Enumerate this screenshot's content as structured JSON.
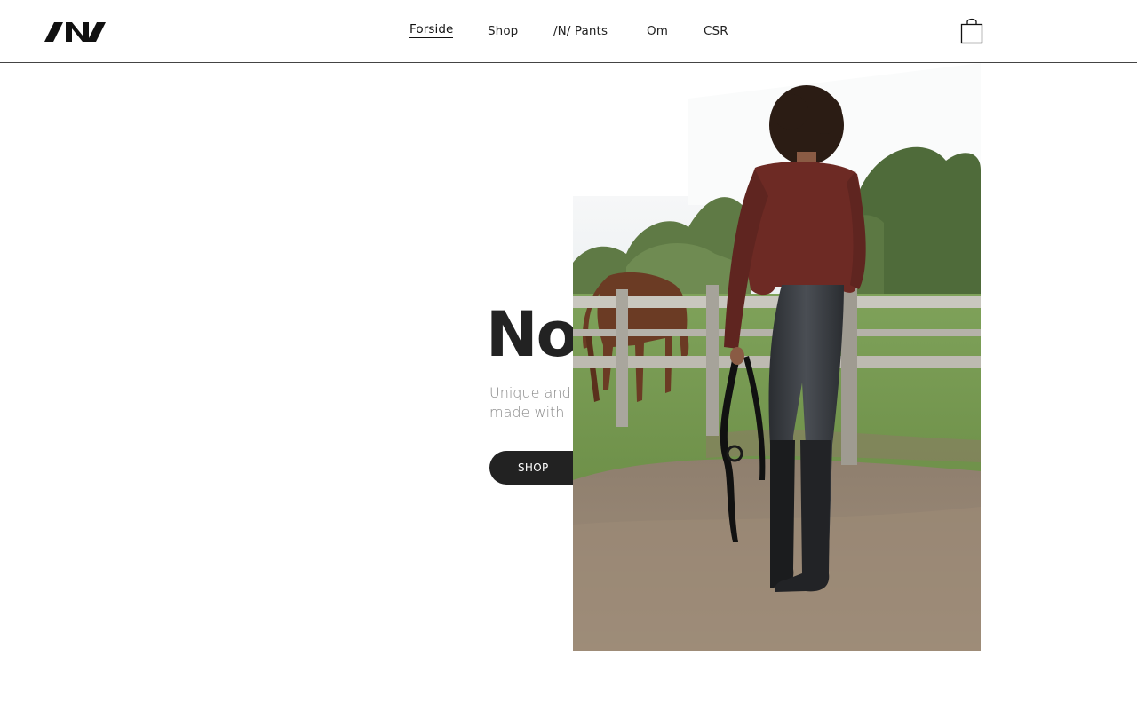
{
  "header": {
    "logo_text": "/N/",
    "nav": [
      {
        "label": "Forside",
        "active": true
      },
      {
        "label": "Shop",
        "active": false
      },
      {
        "label": "/N/ Pants",
        "active": false
      },
      {
        "label": "Om",
        "active": false
      },
      {
        "label": "CSR",
        "active": false
      }
    ],
    "cart_icon": "shopping-bag-icon"
  },
  "hero": {
    "title": "No",
    "subtitle_lines": [
      "Unique and",
      "made with"
    ],
    "cta_label": "SHOP",
    "image_description_icon": "hero-photo"
  },
  "colors": {
    "text_dark": "#222222",
    "text_muted": "#888888",
    "button_bg": "#222222",
    "button_text": "#ffffff",
    "header_border": "#444444"
  }
}
